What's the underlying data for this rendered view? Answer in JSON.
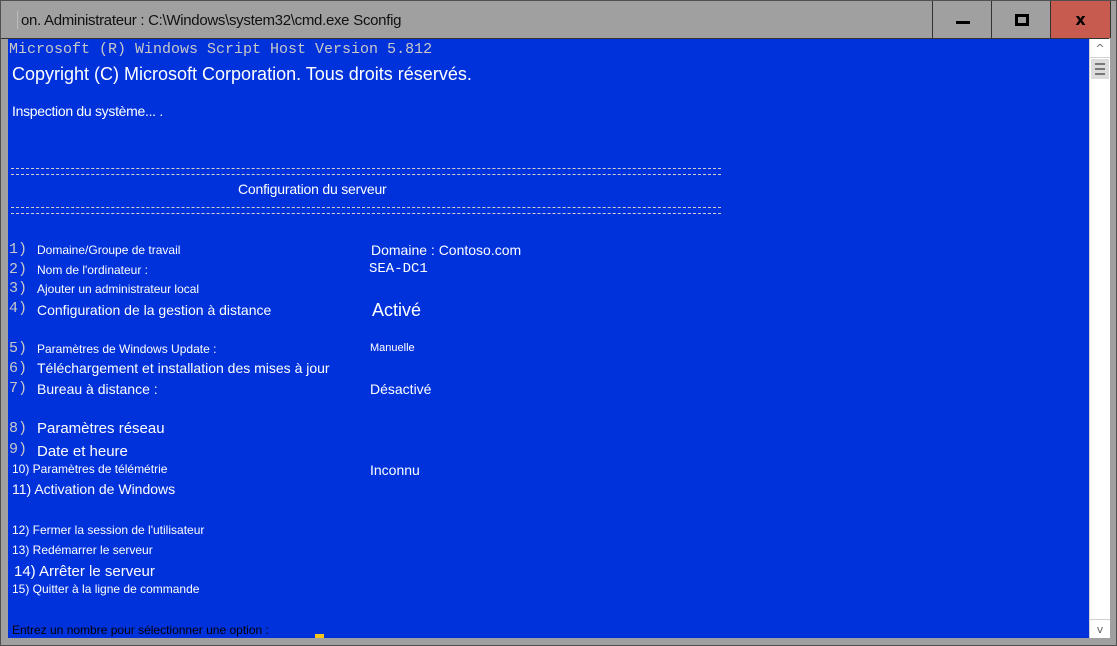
{
  "window": {
    "title": "on. Administrateur : C:\\Windows\\system32\\cmd.exe",
    "title_app": "Sconfig",
    "controls": {
      "minimize": "minimize-icon",
      "maximize": "maximize-icon",
      "close": "x"
    }
  },
  "console": {
    "header_line1": "Microsoft (R) Windows Script Host Version 5.812",
    "header_line2": "Copyright (C) Microsoft Corporation. Tous droits réservés.",
    "inspecting": "Inspection du système...   .",
    "separator": "===============================================================================",
    "section_title": "Configuration du serveur",
    "menu": [
      {
        "num": "1)",
        "label": "Domaine/Groupe de travail",
        "value": "Domaine : Contoso.com"
      },
      {
        "num": "2)",
        "label": "Nom de l'ordinateur  :",
        "value": "SEA-DC1"
      },
      {
        "num": "3)",
        "label": "Ajouter un administrateur local",
        "value": ""
      },
      {
        "num": "4)",
        "label": "Configuration de la gestion à distance",
        "value": "Activé"
      },
      {
        "num": "5)",
        "label": "Paramètres de Windows Update :",
        "value": "Manuelle"
      },
      {
        "num": "6)",
        "label": "Téléchargement et installation des mises à jour",
        "value": ""
      },
      {
        "num": "7)",
        "label": "Bureau à distance :",
        "value": "Désactivé"
      },
      {
        "num": "8)",
        "label": "Paramètres réseau",
        "value": ""
      },
      {
        "num": "9)",
        "label": "Date et heure",
        "value": ""
      },
      {
        "num": "",
        "label": "10) Paramètres de télémétrie",
        "value": "Inconnu"
      },
      {
        "num": "",
        "label": "11) Activation de Windows",
        "value": ""
      },
      {
        "num": "",
        "label": "12) Fermer la session de l'utilisateur",
        "value": ""
      },
      {
        "num": "",
        "label": "13) Redémarrer le serveur",
        "value": ""
      },
      {
        "num": "",
        "label": "14) Arrêter le serveur",
        "value": ""
      },
      {
        "num": "",
        "label": "15) Quitter à la ligne de commande",
        "value": ""
      }
    ],
    "prompt": "Entrez un nombre pour sélectionner une option :"
  },
  "scrollbar": {
    "up": "^",
    "down": "v"
  },
  "colors": {
    "console_bg": "#0032dc",
    "close_button": "#c75b50",
    "cursor": "#f5c518"
  }
}
